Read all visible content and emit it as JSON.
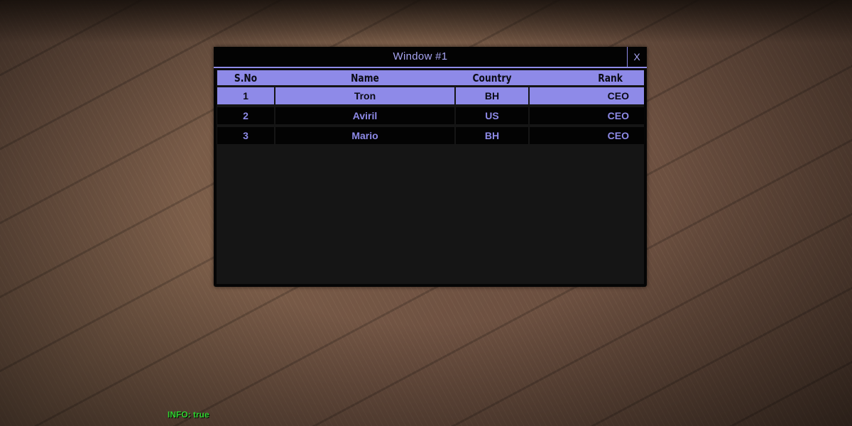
{
  "window": {
    "title": "Window #1",
    "close_label": "X"
  },
  "table": {
    "columns": [
      "S.No",
      "Name",
      "Country",
      "Rank"
    ],
    "rows": [
      {
        "sno": "1",
        "name": "Tron",
        "country": "BH",
        "rank": "CEO",
        "selected": true
      },
      {
        "sno": "2",
        "name": "Aviril",
        "country": "US",
        "rank": "CEO",
        "selected": false
      },
      {
        "sno": "3",
        "name": "Mario",
        "country": "BH",
        "rank": "CEO",
        "selected": false
      }
    ]
  },
  "status": {
    "info_text": "INFO: true"
  },
  "colors": {
    "accent": "#8e8ae8",
    "window_bg": "#050505",
    "info_text": "#2fd12f"
  }
}
